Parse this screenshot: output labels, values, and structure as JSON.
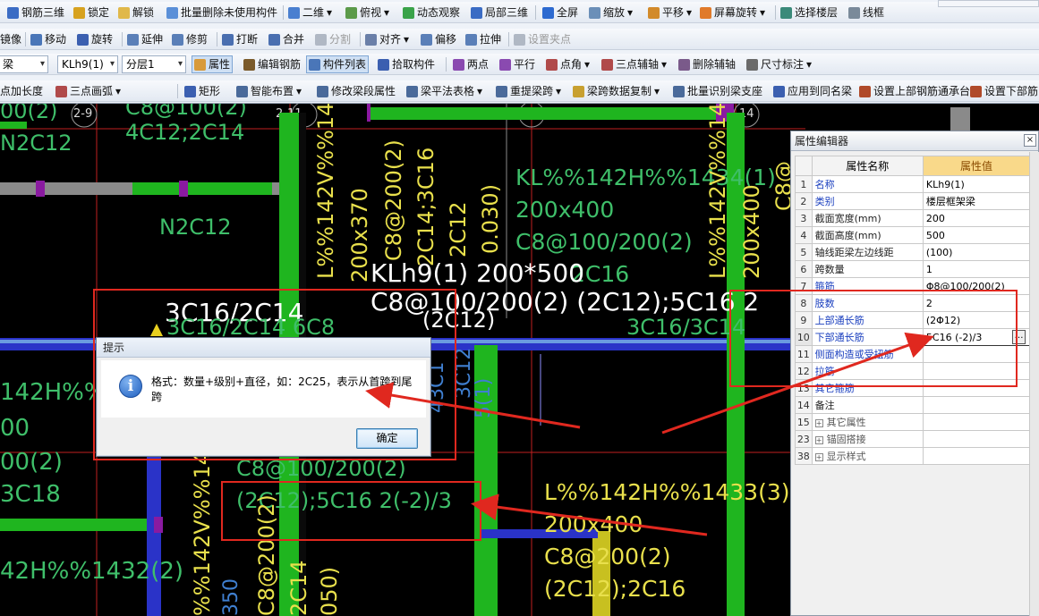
{
  "toolbar": {
    "row1": [
      {
        "label": "钢筋三维",
        "icon": "rebar-3d-icon"
      },
      {
        "label": "锁定",
        "icon": "lock-icon"
      },
      {
        "label": "解锁",
        "icon": "unlock-icon"
      },
      {
        "label": "批量删除未使用构件",
        "icon": "batch-delete-icon"
      },
      {
        "label": "二维",
        "icon": "2d-view-icon"
      },
      {
        "label": "俯视",
        "icon": "top-view-icon"
      },
      {
        "label": "动态观察",
        "icon": "orbit-icon"
      },
      {
        "label": "局部三维",
        "icon": "local-3d-icon"
      },
      {
        "label": "全屏",
        "icon": "fullscreen-icon"
      },
      {
        "label": "缩放",
        "icon": "zoom-icon"
      },
      {
        "label": "平移",
        "icon": "pan-icon"
      },
      {
        "label": "屏幕旋转",
        "icon": "screen-rotate-icon"
      },
      {
        "label": "选择楼层",
        "icon": "select-floor-icon"
      },
      {
        "label": "线框",
        "icon": "wireframe-icon"
      }
    ],
    "row2": [
      {
        "label": "镜像",
        "icon": "mirror-icon"
      },
      {
        "label": "移动",
        "icon": "move-icon"
      },
      {
        "label": "旋转",
        "icon": "rotate-icon"
      },
      {
        "label": "延伸",
        "icon": "extend-icon"
      },
      {
        "label": "修剪",
        "icon": "trim-icon"
      },
      {
        "label": "打断",
        "icon": "break-icon"
      },
      {
        "label": "合并",
        "icon": "merge-icon"
      },
      {
        "label": "分割",
        "icon": "split-icon"
      },
      {
        "label": "对齐",
        "icon": "align-icon"
      },
      {
        "label": "偏移",
        "icon": "offset-icon"
      },
      {
        "label": "拉伸",
        "icon": "stretch-icon"
      },
      {
        "label": "设置夹点",
        "icon": "grip-icon"
      }
    ],
    "row3": {
      "type_combo": "梁",
      "member_combo": "KLh9(1)",
      "layer_combo": "分层1",
      "buttons": [
        {
          "label": "属性",
          "icon": "properties-icon"
        },
        {
          "label": "编辑钢筋",
          "icon": "edit-rebar-icon"
        },
        {
          "label": "构件列表",
          "icon": "member-list-icon"
        },
        {
          "label": "拾取构件",
          "icon": "pick-member-icon"
        },
        {
          "label": "两点",
          "icon": "two-point-icon"
        },
        {
          "label": "平行",
          "icon": "parallel-icon"
        },
        {
          "label": "点角",
          "icon": "point-angle-icon"
        },
        {
          "label": "三点辅轴",
          "icon": "three-point-axis-icon"
        },
        {
          "label": "删除辅轴",
          "icon": "delete-axis-icon"
        },
        {
          "label": "尺寸标注",
          "icon": "dimension-icon"
        }
      ]
    },
    "row4": [
      {
        "label": "点加长度",
        "icon": "point-length-icon"
      },
      {
        "label": "三点画弧",
        "icon": "arc-icon"
      },
      {
        "label": "矩形",
        "icon": "rectangle-icon"
      },
      {
        "label": "智能布置",
        "icon": "smart-layout-icon"
      },
      {
        "label": "修改梁段属性",
        "icon": "modify-beam-icon"
      },
      {
        "label": "梁平法表格",
        "icon": "beam-table-icon"
      },
      {
        "label": "重提梁跨",
        "icon": "re-span-icon"
      },
      {
        "label": "梁跨数据复制",
        "icon": "span-copy-icon"
      },
      {
        "label": "批量识别梁支座",
        "icon": "identify-support-icon"
      },
      {
        "label": "应用到同名梁",
        "icon": "apply-same-icon"
      },
      {
        "label": "设置上部钢筋通承台",
        "icon": "top-rebar-icon"
      },
      {
        "label": "设置下部筋",
        "icon": "bottom-rebar-icon"
      }
    ]
  },
  "canvas": {
    "grid_labels": [
      "2-9",
      "2-11",
      "2-13",
      "14"
    ],
    "texts": {
      "t_tl1": "00(2)",
      "t_tl2": "C8@100(2)",
      "t_tl3": "N2C12",
      "t_tl4": "4C12;2C14",
      "t_mid_n2c12": "N2C12",
      "t_kl_main": "KL%%142H%%1434(1)",
      "t_kl_size": "200x400",
      "t_kl_stir": "C8@100/200(2)",
      "t_kl_2c16": "2C16",
      "t_big1": "KLh9(1) 200*500",
      "t_big2": "C8@100/200(2) (2C12);5C16 2",
      "t_big2b": "(2C12)",
      "t_big3": "3C16/2C14",
      "t_big3b": "3C16/2C14 6C8",
      "t_big3c": "3C16/3C14",
      "t_left_142": "142H%%",
      "t_left_00": "00",
      "t_left_200": "00(2)",
      "t_left_3c18": "3C18",
      "t_left_bot": "42H%%1432(2)",
      "t_mid_c8": "C8@100/200(2)",
      "t_mid_bot": "(2C12);5C16 2(-2)/3",
      "t_br1": "L%%142H%%1433(3)",
      "t_br2": "200x400",
      "t_br3": "C8@200(2)",
      "t_br4": "(2C12);2C16",
      "v_1": "L%%142V%%14",
      "v_2": "200x370",
      "v_3": "C8@200(2)",
      "v_4": "2C14;3C16",
      "v_5": "2C12",
      "v_6": "0.030)",
      "v_7": "L%%142V%%14",
      "v_8": "200x400",
      "v_9": "C8@",
      "v_10": "%%142V%%143",
      "v_11": "C8@200(2)",
      "v_12": "2C14",
      "v_13": "050)",
      "v_14": "350",
      "v_15": "5(1)",
      "v_16": "3C12",
      "v_17": "43C1"
    }
  },
  "dialog": {
    "title": "提示",
    "message": "格式：数量+级别+直径，如：2C25，表示从首跨到尾跨",
    "ok_label": "确定"
  },
  "prop_editor": {
    "title": "属性编辑器",
    "close": "×",
    "col_name": "属性名称",
    "col_value": "属性值",
    "rows": [
      {
        "n": "1",
        "name": "名称",
        "value": "KLh9(1)"
      },
      {
        "n": "2",
        "name": "类别",
        "value": "楼层框架梁"
      },
      {
        "n": "3",
        "name": "截面宽度(mm)",
        "value": "200"
      },
      {
        "n": "4",
        "name": "截面高度(mm)",
        "value": "500"
      },
      {
        "n": "5",
        "name": "轴线距梁左边线距",
        "value": "(100)"
      },
      {
        "n": "6",
        "name": "跨数量",
        "value": "1"
      },
      {
        "n": "7",
        "name": "箍筋",
        "value": "Φ8@100/200(2)"
      },
      {
        "n": "8",
        "name": "肢数",
        "value": "2"
      },
      {
        "n": "9",
        "name": "上部通长筋",
        "value": "(2Φ12)"
      },
      {
        "n": "10",
        "name": "下部通长筋",
        "value": "5C16 (-2)/3"
      },
      {
        "n": "11",
        "name": "侧面构造或受扭筋",
        "value": ""
      },
      {
        "n": "12",
        "name": "拉筋",
        "value": ""
      },
      {
        "n": "13",
        "name": "其它箍筋",
        "value": ""
      },
      {
        "n": "14",
        "name": "备注",
        "value": ""
      },
      {
        "n": "15",
        "name": "其它属性",
        "value": ""
      },
      {
        "n": "23",
        "name": "锚固搭接",
        "value": ""
      },
      {
        "n": "38",
        "name": "显示样式",
        "value": ""
      }
    ],
    "ellipsis": "…"
  },
  "colors": {
    "beam_green": "#1fb51f",
    "beam_blue": "#2a33c8",
    "beam_gray": "#9a9a9a",
    "beam_magenta": "#8a1aa0",
    "text_green": "#3fbf6a",
    "text_yellow": "#e9e04c",
    "annotation_red": "#e0281f"
  }
}
